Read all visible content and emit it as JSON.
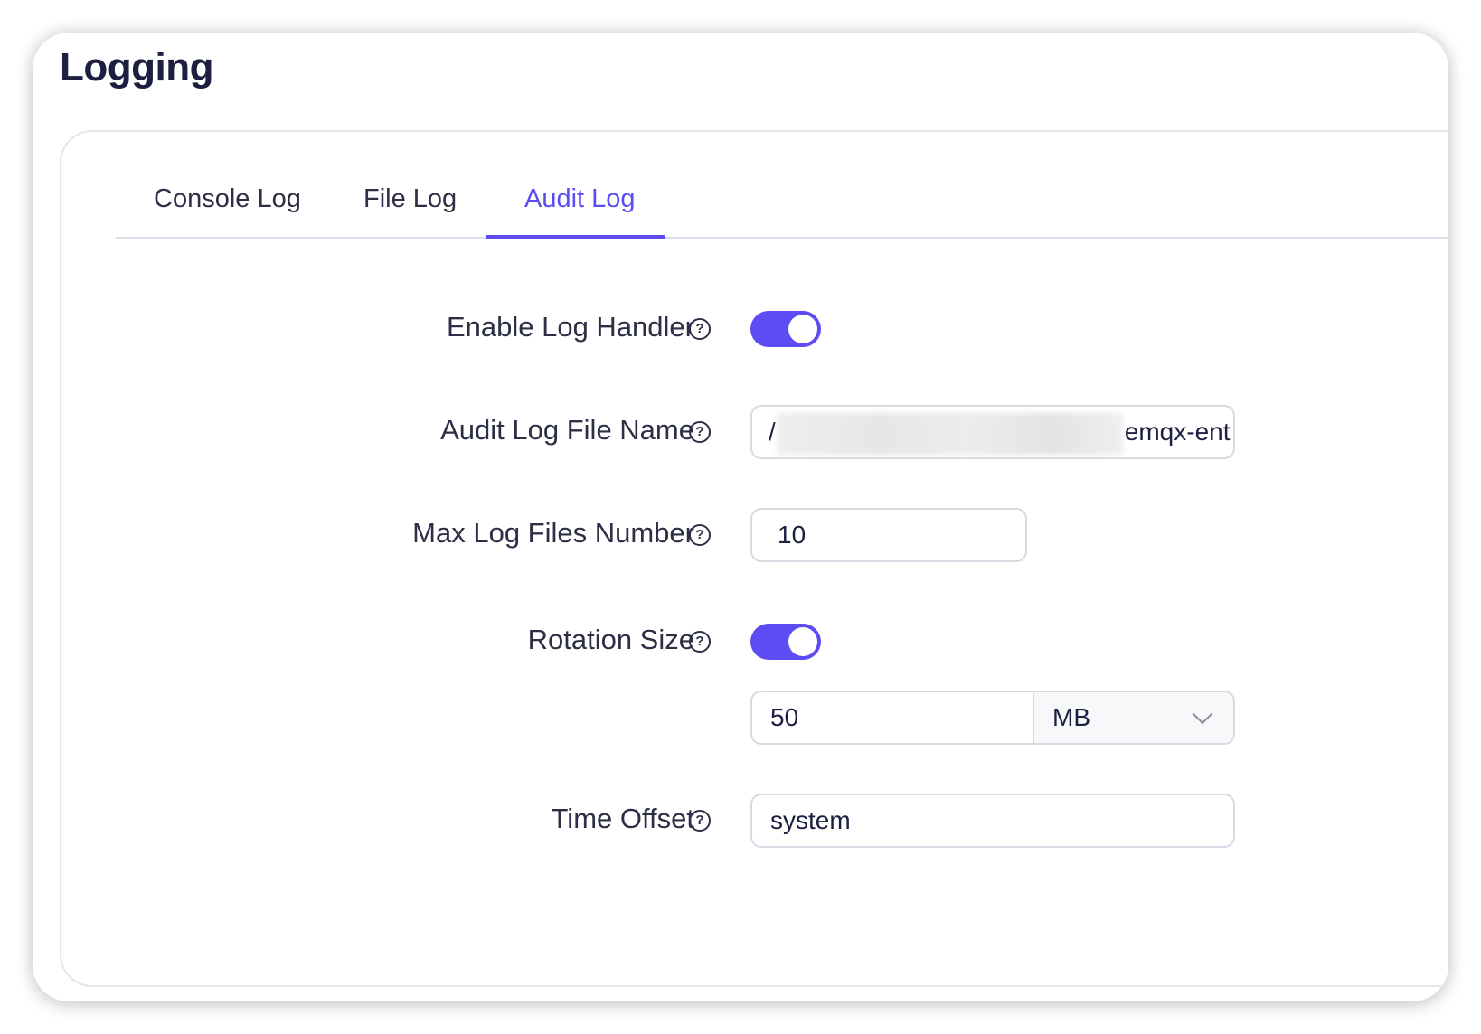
{
  "page": {
    "title": "Logging"
  },
  "tabs": [
    {
      "label": "Console Log",
      "active": false
    },
    {
      "label": "File Log",
      "active": false
    },
    {
      "label": "Audit Log",
      "active": true
    }
  ],
  "form": {
    "enable_log_handler": {
      "label": "Enable Log Handler",
      "enabled": true
    },
    "audit_log_file_name": {
      "label": "Audit Log File Name",
      "value_prefix": "/",
      "value_suffix": "emqx-ent",
      "redacted": true
    },
    "max_log_files_number": {
      "label": "Max Log Files Number",
      "value": "10"
    },
    "rotation_size": {
      "label": "Rotation Size",
      "enabled": true,
      "value": "50",
      "unit": "MB"
    },
    "time_offset": {
      "label": "Time Offset",
      "value": "system"
    }
  },
  "icons": {
    "help": "question-circle-icon",
    "select_arrow": "chevron-down-icon"
  },
  "colors": {
    "accent": "#5d4cf3",
    "title": "#1c1f3f",
    "text": "#2c2f45",
    "border": "#d7d9e3"
  }
}
